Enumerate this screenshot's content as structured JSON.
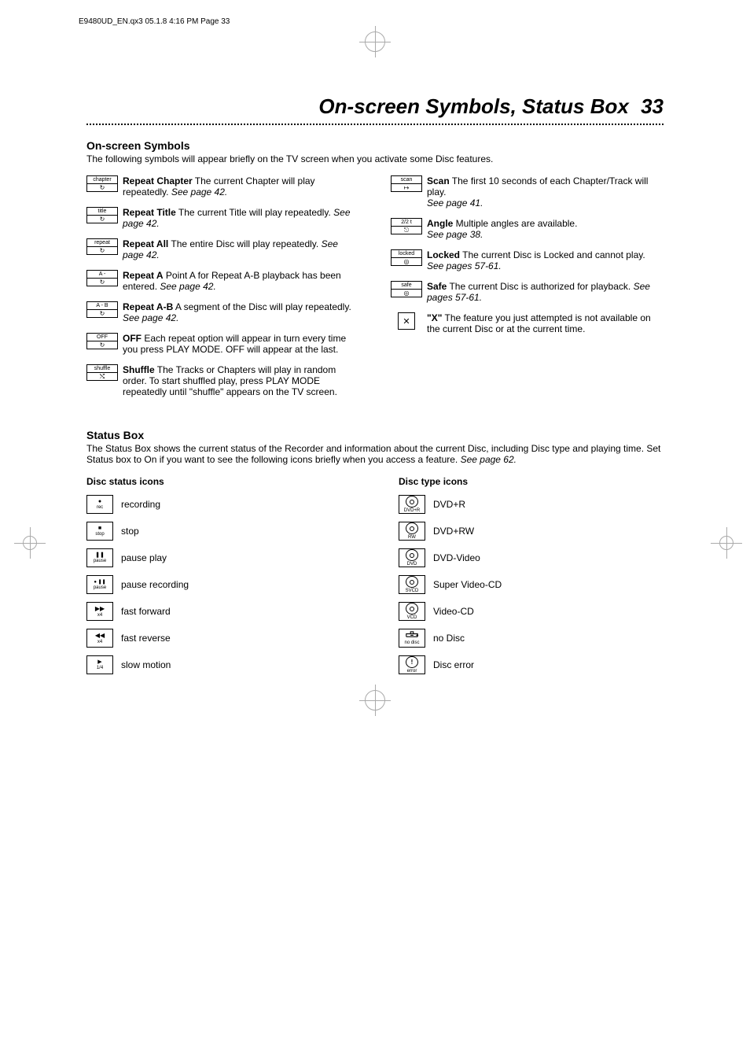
{
  "header_line": "E9480UD_EN.qx3  05.1.8  4:16 PM  Page 33",
  "page_title": "On-screen Symbols, Status Box",
  "page_number": "33",
  "sections": {
    "onscreen": {
      "heading": "On-screen Symbols",
      "intro": "The following symbols will appear briefly on the TV screen when you activate some Disc features.",
      "left": [
        {
          "icon_top": "chapter",
          "icon_bottom": "↻",
          "term": "Repeat Chapter",
          "desc": " The current Chapter will play repeatedly. ",
          "ref": "See page 42."
        },
        {
          "icon_top": "title",
          "icon_bottom": "↻",
          "term": "Repeat Title",
          "desc": " The current Title will play repeatedly. ",
          "ref": "See page 42."
        },
        {
          "icon_top": "repeat",
          "icon_bottom": "↻",
          "term": "Repeat All",
          "desc": " The entire Disc will play repeatedly. ",
          "ref": "See page 42."
        },
        {
          "icon_top": "A -",
          "icon_bottom": "↻",
          "term": "Repeat A",
          "desc": "  Point A for Repeat A-B playback has been entered. ",
          "ref": "See page 42."
        },
        {
          "icon_top": "A - B",
          "icon_bottom": "↻",
          "term": "Repeat A-B",
          "desc": " A segment of the Disc will play repeatedly. ",
          "ref": "See page 42."
        },
        {
          "icon_top": "OFF",
          "icon_bottom": "↻",
          "term": "OFF",
          "desc": " Each repeat option will appear in turn every time you press PLAY MODE. OFF will appear at the last.",
          "ref": ""
        },
        {
          "icon_top": "shuffle",
          "icon_bottom": "⤭",
          "term": "Shuffle",
          "desc": " The Tracks or Chapters will play in random order.  To start shuffled play, press PLAY MODE repeatedly until \"shuffle\" appears on the TV screen.",
          "ref": ""
        }
      ],
      "right": [
        {
          "icon_top": "scan",
          "icon_bottom": "↦",
          "term": "Scan",
          "desc": " The first 10 seconds of each Chapter/Track will play. ",
          "ref": "See page 41."
        },
        {
          "icon_top": "2/2 t",
          "icon_bottom": "⎋",
          "term": "Angle",
          "desc": " Multiple angles are available. ",
          "ref": "See page 38."
        },
        {
          "icon_top": "locked",
          "icon_bottom": "◎",
          "term": "Locked",
          "desc": " The current Disc is Locked and cannot play. ",
          "ref": "See pages 57-61."
        },
        {
          "icon_top": "safe",
          "icon_bottom": "◎",
          "term": "Safe",
          "desc": " The current Disc is authorized for playback. ",
          "ref": "See pages 57-61."
        },
        {
          "icon_top": "",
          "icon_bottom": "✕",
          "term": "\"X\"",
          "desc": " The feature you just attempted is not available on the current Disc or at the current time.",
          "ref": "",
          "x_style": true
        }
      ]
    },
    "status": {
      "heading": "Status Box",
      "intro": "The Status Box shows the current status of the Recorder and information about the current Disc, including Disc type and playing time. Set Status box to On if you want to see the following icons briefly when you access a feature. ",
      "intro_ref": "See page 62.",
      "disc_status": {
        "heading": "Disc status icons",
        "items": [
          {
            "sym": "●",
            "lbl": "rec",
            "text": "recording"
          },
          {
            "sym": "■",
            "lbl": "stop",
            "text": "stop"
          },
          {
            "sym": "❚❚",
            "lbl": "pause",
            "text": "pause play"
          },
          {
            "sym": "● ❚❚",
            "lbl": "pause",
            "text": "pause recording"
          },
          {
            "sym": "▶▶",
            "lbl": "x4",
            "text": "fast forward"
          },
          {
            "sym": "◀◀",
            "lbl": "x4",
            "text": "fast reverse"
          },
          {
            "sym": "▶",
            "lbl": "1/4",
            "text": "slow motion"
          }
        ]
      },
      "disc_type": {
        "heading": "Disc type icons",
        "items": [
          {
            "sym": "disc",
            "lbl": "DVD+R",
            "text": "DVD+R"
          },
          {
            "sym": "disc",
            "lbl": "RW",
            "text": "DVD+RW"
          },
          {
            "sym": "disc",
            "lbl": "DVD",
            "text": "DVD-Video"
          },
          {
            "sym": "disc",
            "lbl": "SVCD",
            "text": "Super Video-CD"
          },
          {
            "sym": "disc",
            "lbl": "VCD",
            "text": "Video-CD"
          },
          {
            "sym": "nodisc",
            "lbl": "no disc",
            "text": "no Disc"
          },
          {
            "sym": "err",
            "lbl": "error",
            "text": "Disc error"
          }
        ]
      }
    }
  }
}
